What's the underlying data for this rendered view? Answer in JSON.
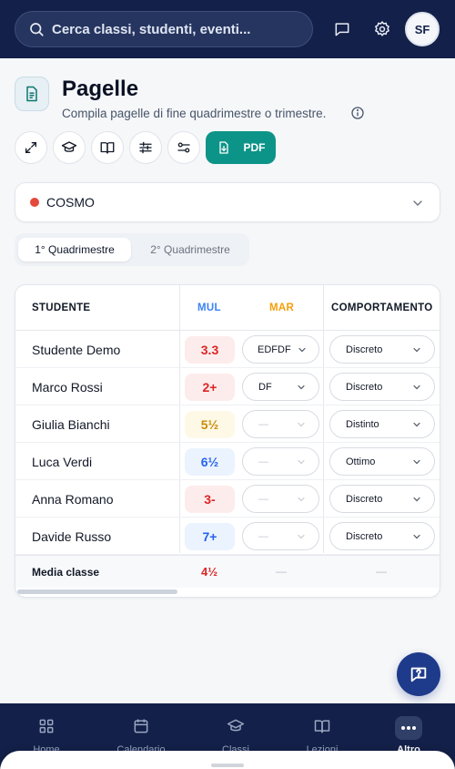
{
  "search": {
    "placeholder": "Cerca classi, studenti, eventi..."
  },
  "user": {
    "initials": "SF"
  },
  "page": {
    "title": "Pagelle",
    "subtitle": "Compila pagelle di fine quadrimestre o trimestre."
  },
  "toolbar": {
    "pdf_label": "PDF"
  },
  "class_selector": {
    "value": "COSMO",
    "dot_color": "#e5483c"
  },
  "terms": [
    "1° Quadrimestre",
    "2° Quadrimestre"
  ],
  "table": {
    "headers": {
      "student": "STUDENTE",
      "mul": "MUL",
      "mar": "MAR",
      "behavior": "COMPORTAMENTO"
    },
    "rows": [
      {
        "name": "Studente Demo",
        "mul": "3.3",
        "mar": "EDFDF",
        "behavior": "Discreto"
      },
      {
        "name": "Marco Rossi",
        "mul": "2+",
        "mar": "DF",
        "behavior": "Discreto"
      },
      {
        "name": "Giulia Bianchi",
        "mul": "5½",
        "mar": "—",
        "behavior": "Distinto"
      },
      {
        "name": "Luca Verdi",
        "mul": "6½",
        "mar": "—",
        "behavior": "Ottimo"
      },
      {
        "name": "Anna Romano",
        "mul": "3-",
        "mar": "—",
        "behavior": "Discreto"
      },
      {
        "name": "Davide Russo",
        "mul": "7+",
        "mar": "—",
        "behavior": "Discreto"
      }
    ],
    "footer": {
      "label": "Media classe",
      "mul_avg": "4½",
      "mar_avg": "—",
      "behavior_avg": "—"
    }
  },
  "nav": [
    {
      "label": "Home"
    },
    {
      "label": "Calendario"
    },
    {
      "label": "Classi"
    },
    {
      "label": "Lezioni"
    },
    {
      "label": "Altro"
    }
  ],
  "colors": {
    "topbar": "#132049",
    "accent_teal": "#0d9488",
    "mul_header": "#3b82f6",
    "mar_header": "#f59e0b",
    "grade_fail": "#dc2626",
    "grade_warn": "#ca8a04",
    "grade_pass": "#2563eb"
  }
}
